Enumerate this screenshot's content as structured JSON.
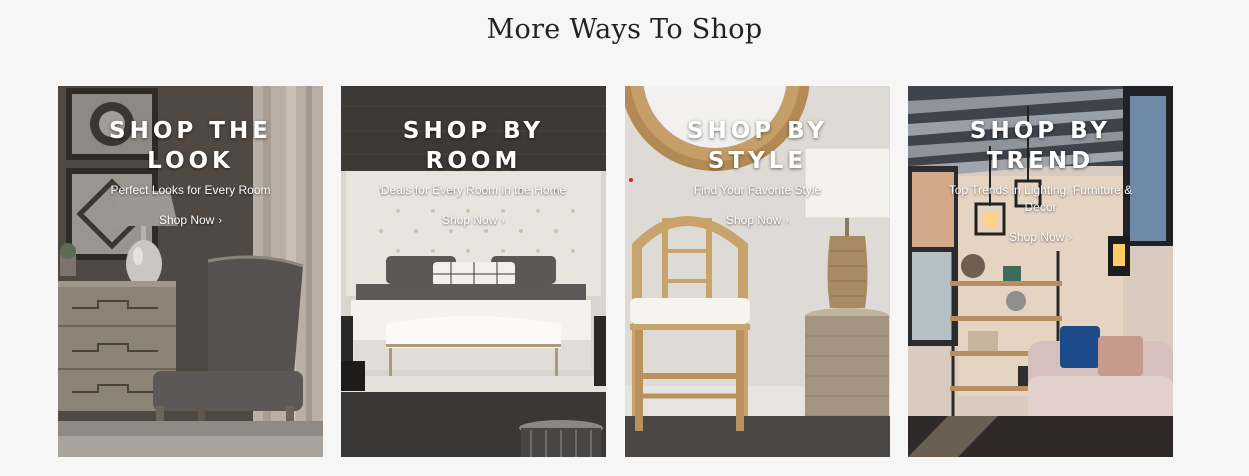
{
  "section": {
    "title": "More Ways To Shop"
  },
  "cards": [
    {
      "title": "SHOP THE LOOK",
      "subtitle": "Perfect Looks for Every Room",
      "link": "Shop Now",
      "link_icon": "chevron-right-icon"
    },
    {
      "title": "SHOP BY ROOM",
      "subtitle": "Deals for Every Room in the Home",
      "link": "Shop Now",
      "link_icon": "chevron-right-icon"
    },
    {
      "title": "SHOP BY STYLE",
      "subtitle": "Find Your Favorite Style",
      "link": "Shop Now",
      "link_icon": "chevron-right-icon"
    },
    {
      "title": "SHOP BY TREND",
      "subtitle": "Top Trends in Lighting, Furniture & Decor",
      "link": "Shop Now",
      "link_icon": "chevron-right-icon"
    }
  ],
  "colors": {
    "background": "#f6f6f6",
    "title_text": "#222222",
    "overlay_text": "#ffffff",
    "accent_dot": "#d2202f"
  }
}
